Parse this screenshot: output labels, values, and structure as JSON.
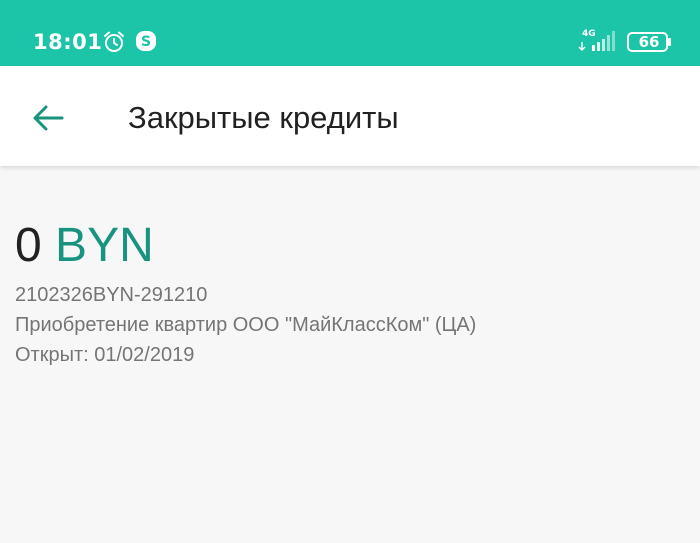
{
  "status_bar": {
    "time": "18:01",
    "network_type": "4G",
    "battery_level": "66",
    "icons": [
      "alarm-icon",
      "skype-icon",
      "signal-icon",
      "battery-icon"
    ],
    "background_color": "#1dc5a8"
  },
  "app_bar": {
    "back_icon": "arrow-left-icon",
    "title": "Закрытые кредиты",
    "accent_color": "#17937f"
  },
  "loan": {
    "amount": "0",
    "currency": "BYN",
    "contract_id": "2102326BYN-291210",
    "purpose": "Приобретение квартир ООО \"МайКлассКом\" (ЦА)",
    "opened": "Открыт: 01/02/2019"
  }
}
